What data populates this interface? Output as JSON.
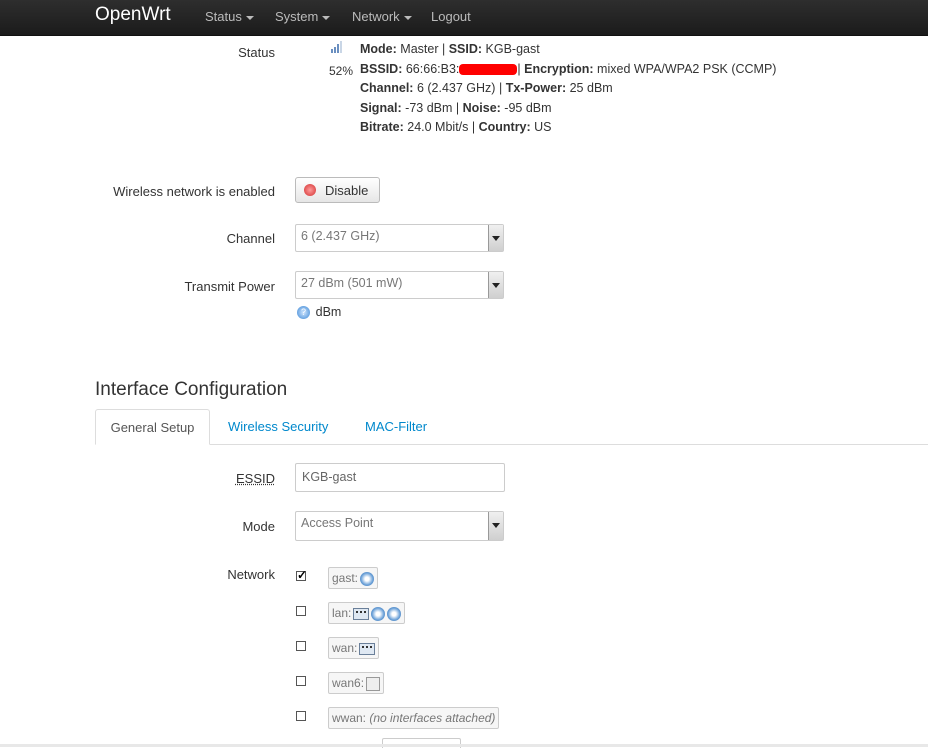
{
  "header": {
    "brand": "OpenWrt",
    "menu": [
      "Status",
      "System",
      "Network",
      "Logout"
    ]
  },
  "status": {
    "label": "Status",
    "signal_percent": "52%",
    "mode_label": "Mode:",
    "mode_value": "Master",
    "ssid_label": "SSID:",
    "ssid_value": "KGB-gast",
    "bssid_label": "BSSID:",
    "bssid_value": "66:66:B3:",
    "encryption_label": "Encryption:",
    "encryption_value": "mixed WPA/WPA2 PSK (CCMP)",
    "channel_label": "Channel:",
    "channel_value": "6 (2.437 GHz)",
    "txpower_label": "Tx-Power:",
    "txpower_value": "25 dBm",
    "signal_label": "Signal:",
    "signal_value": "-73 dBm",
    "noise_label": "Noise:",
    "noise_value": "-95 dBm",
    "bitrate_label": "Bitrate:",
    "bitrate_value": "24.0 Mbit/s",
    "country_label": "Country:",
    "country_value": "US"
  },
  "wireless": {
    "enabled_label": "Wireless network is enabled",
    "disable_button": "Disable",
    "channel_label": "Channel",
    "channel_value": "6 (2.437 GHz)",
    "txpower_label": "Transmit Power",
    "txpower_value": "27 dBm (501 mW)",
    "txpower_help": "dBm"
  },
  "interface": {
    "title": "Interface Configuration",
    "tabs": [
      "General Setup",
      "Wireless Security",
      "MAC-Filter"
    ],
    "essid_label": "ESSID",
    "essid_value": "KGB-gast",
    "mode_label": "Mode",
    "mode_value": "Access Point",
    "network_label": "Network",
    "networks": [
      {
        "name": "gast:",
        "checked": true
      },
      {
        "name": "lan:",
        "checked": false
      },
      {
        "name": "wan:",
        "checked": false
      },
      {
        "name": "wan6:",
        "checked": false
      },
      {
        "name": "wwan:",
        "checked": false,
        "note": "(no interfaces attached)"
      }
    ]
  },
  "colors": {
    "link": "#0088cc",
    "redaction": "#ff0000",
    "topbar": "#222222"
  }
}
